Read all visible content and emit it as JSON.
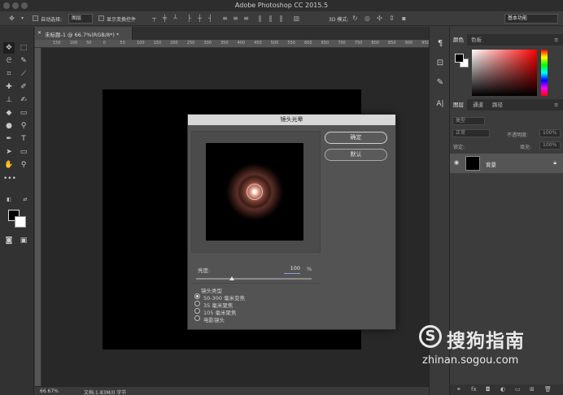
{
  "app": {
    "title": "Adobe Photoshop CC 2015.5"
  },
  "options_bar": {
    "auto_select_label": "自动选择:",
    "auto_select_value": "图层",
    "show_transform_label": "显示变换控件",
    "mode_3d_label": "3D 模式:",
    "workspace": "基本功能"
  },
  "document": {
    "tab_title": "未标题-1 @ 66.7%(RGB/8*) *",
    "ruler_ticks": [
      "150",
      "100",
      "50",
      "0",
      "50",
      "100",
      "150",
      "200",
      "250",
      "300",
      "350",
      "400",
      "450",
      "500",
      "550",
      "600",
      "650",
      "700",
      "750",
      "800",
      "850",
      "900",
      "950"
    ],
    "canvas_color": "#000000"
  },
  "status": {
    "zoom": "66.67%",
    "doc_info": "文档:1.83M/0 字节"
  },
  "dialog": {
    "title": "镜头光晕",
    "ok_label": "确定",
    "reset_label": "默认",
    "brightness_label": "亮度:",
    "brightness_value": "100",
    "brightness_unit": "%",
    "brightness_percent": 100,
    "lens_type_label": "镜头类型",
    "lens_types": [
      {
        "label": "50-300 毫米变焦",
        "selected": true
      },
      {
        "label": "35 毫米聚焦",
        "selected": false
      },
      {
        "label": "105 毫米聚焦",
        "selected": false
      },
      {
        "label": "电影镜头",
        "selected": false
      }
    ]
  },
  "color_panel": {
    "tabs": [
      "颜色",
      "色板"
    ],
    "foreground": "#000000",
    "background": "#ffffff"
  },
  "layers_panel": {
    "tabs": [
      "图层",
      "通道",
      "路径"
    ],
    "filter_label": "类型",
    "blend_mode": "正常",
    "opacity_label": "不透明度:",
    "opacity_value": "100%",
    "lock_label": "锁定:",
    "fill_label": "填充:",
    "fill_value": "100%",
    "layers": [
      {
        "name": "背景",
        "locked": true,
        "visible": true
      }
    ]
  },
  "watermark": {
    "brand": "搜狗指南",
    "url": "zhinan.sogou.com"
  }
}
